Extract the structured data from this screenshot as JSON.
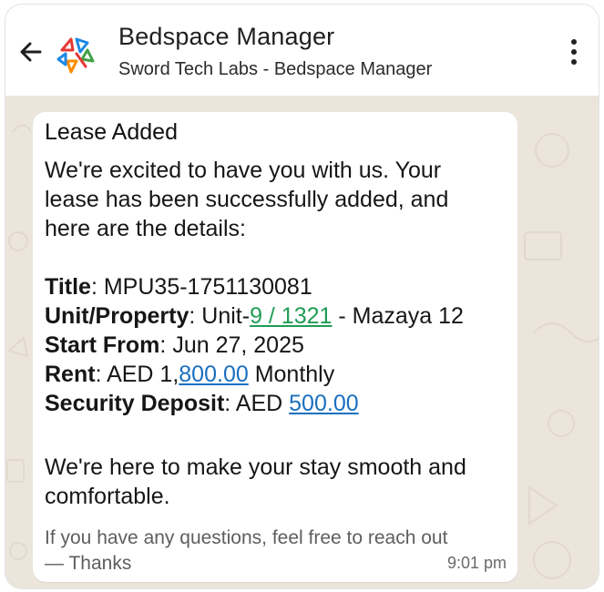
{
  "header": {
    "title": "Bedspace Manager",
    "subtitle": "Sword Tech Labs - Bedspace Manager",
    "back_icon": "arrow-left-icon",
    "menu_icon": "kebab-menu-icon",
    "logo_colors": [
      "#e53935",
      "#1e88e5",
      "#43a047",
      "#fb8c00"
    ]
  },
  "message": {
    "heading": "Lease Added",
    "intro_lines": [
      "We're excited to have you with us. Your",
      "lease has been successfully added, and",
      "here are the details:"
    ],
    "fields": {
      "title_label": "Title",
      "title_value": "MPU35-1751130081",
      "unit_label": "Unit/Property",
      "unit_prefix": "Unit-",
      "unit_link": "9 / 1321",
      "unit_suffix": " - Mazaya 12",
      "start_label": "Start From",
      "start_value": "Jun 27, 2025",
      "rent_label": "Rent",
      "rent_prefix": "AED 1,",
      "rent_link": "800.00",
      "rent_suffix": " Monthly",
      "deposit_label": "Security Deposit",
      "deposit_prefix": "AED ",
      "deposit_link": "500.00"
    },
    "closing_lines": [
      "We're here to make your stay smooth and",
      "comfortable."
    ],
    "footer_lines": [
      "If you have any questions, feel free to reach out",
      "— Thanks"
    ],
    "time": "9:01 pm"
  },
  "colors": {
    "link_green": "#1f9d55",
    "link_blue": "#1a6fbf",
    "wallpaper": "#ebe5dc"
  }
}
